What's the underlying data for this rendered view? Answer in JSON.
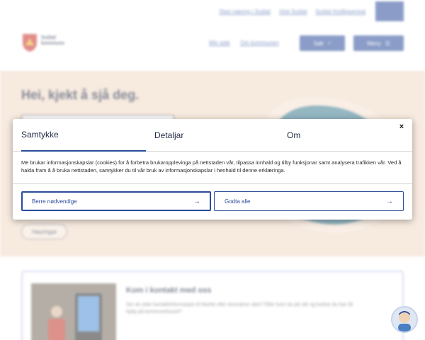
{
  "top_links": [
    {
      "label": "Start næring i Suldal"
    },
    {
      "label": "Visit Suldal"
    },
    {
      "label": "Suldal frivilligsentral"
    }
  ],
  "header": {
    "logo_text_line1": "Suldal",
    "logo_text_line2": "kommune",
    "link_my_page": "Min side",
    "link_about": "Om kommunen",
    "search_label": "Søk",
    "menu_label": "Meny"
  },
  "hero": {
    "title": "Hei, kjekt å sjå deg.",
    "chip_label": "Høyringar"
  },
  "contact": {
    "title": "Kom i kontakt med oss",
    "text": "Ser du etter kontaktinformasjon til tilsette eller tenestene våre? Eller lurer du på når og korleis du kan få hjelp på kommunehuset?"
  },
  "consent": {
    "tabs": [
      {
        "label": "Samtykke",
        "active": true
      },
      {
        "label": "Detaljar",
        "active": false
      },
      {
        "label": "Om",
        "active": false
      }
    ],
    "close_symbol": "×",
    "body": "Me brukar informasjonskapslar (cookies) for å forbetra brukaropplevinga på nettstaden vår, tilpassa innhald og tilby funksjonar samt analysera trafikken vår. Ved å halda fram å å bruka nettstaden, samtykker du til vår bruk av informasjonskapslar i henhald til denne erklæringa.",
    "button_necessary": "Berre nødvendige",
    "button_accept_all": "Godta alle",
    "arrow_symbol": "→"
  },
  "colors": {
    "accent": "#2b4c9a",
    "hero_bg": "#f1d9c6",
    "lake": "#3d7d92"
  },
  "icons": [
    "external-link-icon",
    "search-icon",
    "menu-icon",
    "close-icon",
    "arrow-right-icon",
    "chatbot-avatar-icon"
  ]
}
